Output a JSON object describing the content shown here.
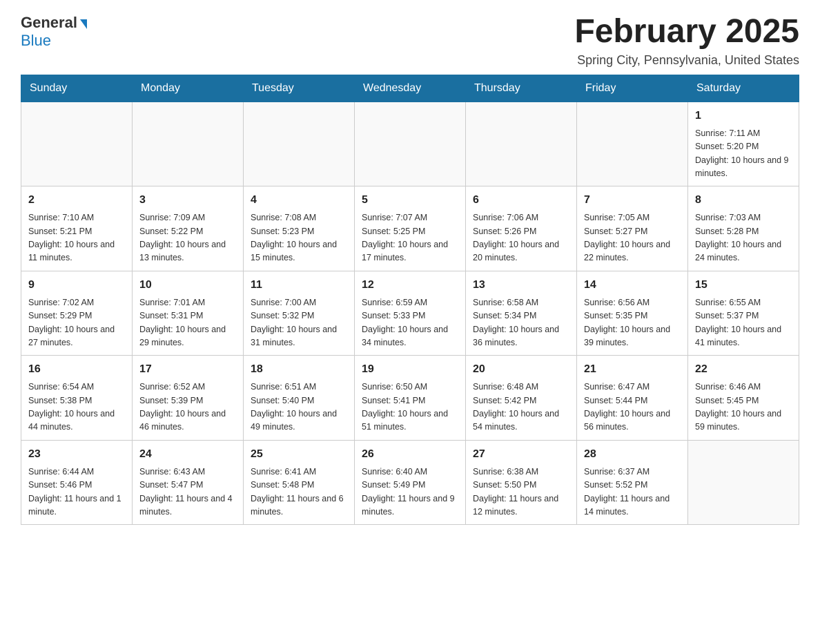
{
  "header": {
    "logo_general": "General",
    "logo_blue": "Blue",
    "month_title": "February 2025",
    "location": "Spring City, Pennsylvania, United States"
  },
  "weekdays": [
    "Sunday",
    "Monday",
    "Tuesday",
    "Wednesday",
    "Thursday",
    "Friday",
    "Saturday"
  ],
  "weeks": [
    [
      {
        "day": "",
        "info": ""
      },
      {
        "day": "",
        "info": ""
      },
      {
        "day": "",
        "info": ""
      },
      {
        "day": "",
        "info": ""
      },
      {
        "day": "",
        "info": ""
      },
      {
        "day": "",
        "info": ""
      },
      {
        "day": "1",
        "info": "Sunrise: 7:11 AM\nSunset: 5:20 PM\nDaylight: 10 hours and 9 minutes."
      }
    ],
    [
      {
        "day": "2",
        "info": "Sunrise: 7:10 AM\nSunset: 5:21 PM\nDaylight: 10 hours and 11 minutes."
      },
      {
        "day": "3",
        "info": "Sunrise: 7:09 AM\nSunset: 5:22 PM\nDaylight: 10 hours and 13 minutes."
      },
      {
        "day": "4",
        "info": "Sunrise: 7:08 AM\nSunset: 5:23 PM\nDaylight: 10 hours and 15 minutes."
      },
      {
        "day": "5",
        "info": "Sunrise: 7:07 AM\nSunset: 5:25 PM\nDaylight: 10 hours and 17 minutes."
      },
      {
        "day": "6",
        "info": "Sunrise: 7:06 AM\nSunset: 5:26 PM\nDaylight: 10 hours and 20 minutes."
      },
      {
        "day": "7",
        "info": "Sunrise: 7:05 AM\nSunset: 5:27 PM\nDaylight: 10 hours and 22 minutes."
      },
      {
        "day": "8",
        "info": "Sunrise: 7:03 AM\nSunset: 5:28 PM\nDaylight: 10 hours and 24 minutes."
      }
    ],
    [
      {
        "day": "9",
        "info": "Sunrise: 7:02 AM\nSunset: 5:29 PM\nDaylight: 10 hours and 27 minutes."
      },
      {
        "day": "10",
        "info": "Sunrise: 7:01 AM\nSunset: 5:31 PM\nDaylight: 10 hours and 29 minutes."
      },
      {
        "day": "11",
        "info": "Sunrise: 7:00 AM\nSunset: 5:32 PM\nDaylight: 10 hours and 31 minutes."
      },
      {
        "day": "12",
        "info": "Sunrise: 6:59 AM\nSunset: 5:33 PM\nDaylight: 10 hours and 34 minutes."
      },
      {
        "day": "13",
        "info": "Sunrise: 6:58 AM\nSunset: 5:34 PM\nDaylight: 10 hours and 36 minutes."
      },
      {
        "day": "14",
        "info": "Sunrise: 6:56 AM\nSunset: 5:35 PM\nDaylight: 10 hours and 39 minutes."
      },
      {
        "day": "15",
        "info": "Sunrise: 6:55 AM\nSunset: 5:37 PM\nDaylight: 10 hours and 41 minutes."
      }
    ],
    [
      {
        "day": "16",
        "info": "Sunrise: 6:54 AM\nSunset: 5:38 PM\nDaylight: 10 hours and 44 minutes."
      },
      {
        "day": "17",
        "info": "Sunrise: 6:52 AM\nSunset: 5:39 PM\nDaylight: 10 hours and 46 minutes."
      },
      {
        "day": "18",
        "info": "Sunrise: 6:51 AM\nSunset: 5:40 PM\nDaylight: 10 hours and 49 minutes."
      },
      {
        "day": "19",
        "info": "Sunrise: 6:50 AM\nSunset: 5:41 PM\nDaylight: 10 hours and 51 minutes."
      },
      {
        "day": "20",
        "info": "Sunrise: 6:48 AM\nSunset: 5:42 PM\nDaylight: 10 hours and 54 minutes."
      },
      {
        "day": "21",
        "info": "Sunrise: 6:47 AM\nSunset: 5:44 PM\nDaylight: 10 hours and 56 minutes."
      },
      {
        "day": "22",
        "info": "Sunrise: 6:46 AM\nSunset: 5:45 PM\nDaylight: 10 hours and 59 minutes."
      }
    ],
    [
      {
        "day": "23",
        "info": "Sunrise: 6:44 AM\nSunset: 5:46 PM\nDaylight: 11 hours and 1 minute."
      },
      {
        "day": "24",
        "info": "Sunrise: 6:43 AM\nSunset: 5:47 PM\nDaylight: 11 hours and 4 minutes."
      },
      {
        "day": "25",
        "info": "Sunrise: 6:41 AM\nSunset: 5:48 PM\nDaylight: 11 hours and 6 minutes."
      },
      {
        "day": "26",
        "info": "Sunrise: 6:40 AM\nSunset: 5:49 PM\nDaylight: 11 hours and 9 minutes."
      },
      {
        "day": "27",
        "info": "Sunrise: 6:38 AM\nSunset: 5:50 PM\nDaylight: 11 hours and 12 minutes."
      },
      {
        "day": "28",
        "info": "Sunrise: 6:37 AM\nSunset: 5:52 PM\nDaylight: 11 hours and 14 minutes."
      },
      {
        "day": "",
        "info": ""
      }
    ]
  ]
}
